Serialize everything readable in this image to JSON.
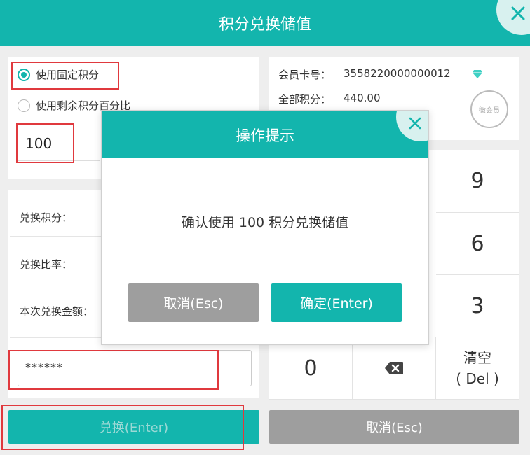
{
  "window": {
    "title": "积分兑换储值"
  },
  "options": {
    "fixed_points_label": "使用固定积分",
    "remaining_percent_label": "使用剩余积分百分比",
    "points_value": "100"
  },
  "fields": {
    "exchange_points_label": "兑换积分：",
    "exchange_ratio_label": "兑换比率：",
    "exchange_amount_label": "本次兑换金额："
  },
  "password": {
    "value": "******"
  },
  "member": {
    "card_label": "会员卡号：",
    "card_number": "3558220000000012",
    "total_points_label": "全部积分：",
    "total_points": "440.00",
    "stamp_text": "微会员"
  },
  "keypad": {
    "keys": [
      "9",
      "6",
      "3",
      "0",
      "清空",
      "( Del )"
    ]
  },
  "buttons": {
    "exchange": "兑换(Enter)",
    "cancel": "取消(Esc)"
  },
  "dialog": {
    "title": "操作提示",
    "message": "确认使用 100 积分兑换储值",
    "cancel": "取消(Esc)",
    "confirm": "确定(Enter)"
  },
  "colors": {
    "accent": "#13b5ad",
    "highlight": "#e0393e",
    "gray_button": "#9e9e9e"
  }
}
